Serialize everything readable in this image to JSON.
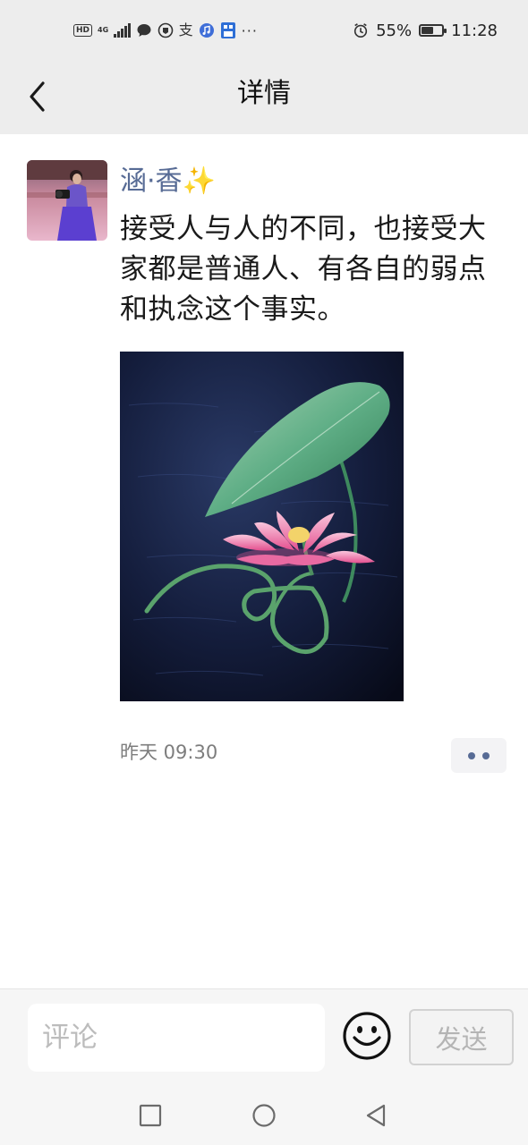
{
  "status_bar": {
    "hd": "HD",
    "network": "4G",
    "network_sub": "46",
    "alipay": "支",
    "more": "···",
    "battery": "55%",
    "battery_level": 0.55,
    "time": "11:28"
  },
  "header": {
    "title": "详情"
  },
  "post": {
    "author": "涵·香✨",
    "text": "接受人与人的不同，也接受大家都是普通人、有各自的弱点和执念这个事实。",
    "timestamp": "昨天 09:30"
  },
  "comment_bar": {
    "placeholder": "评论",
    "send_label": "发送"
  },
  "icons": {
    "back": "chevron-left-icon",
    "more": "more-dots-icon",
    "emoji": "smiley-icon",
    "sys_recents": "square-icon",
    "sys_home": "circle-icon",
    "sys_back": "triangle-back-icon"
  }
}
